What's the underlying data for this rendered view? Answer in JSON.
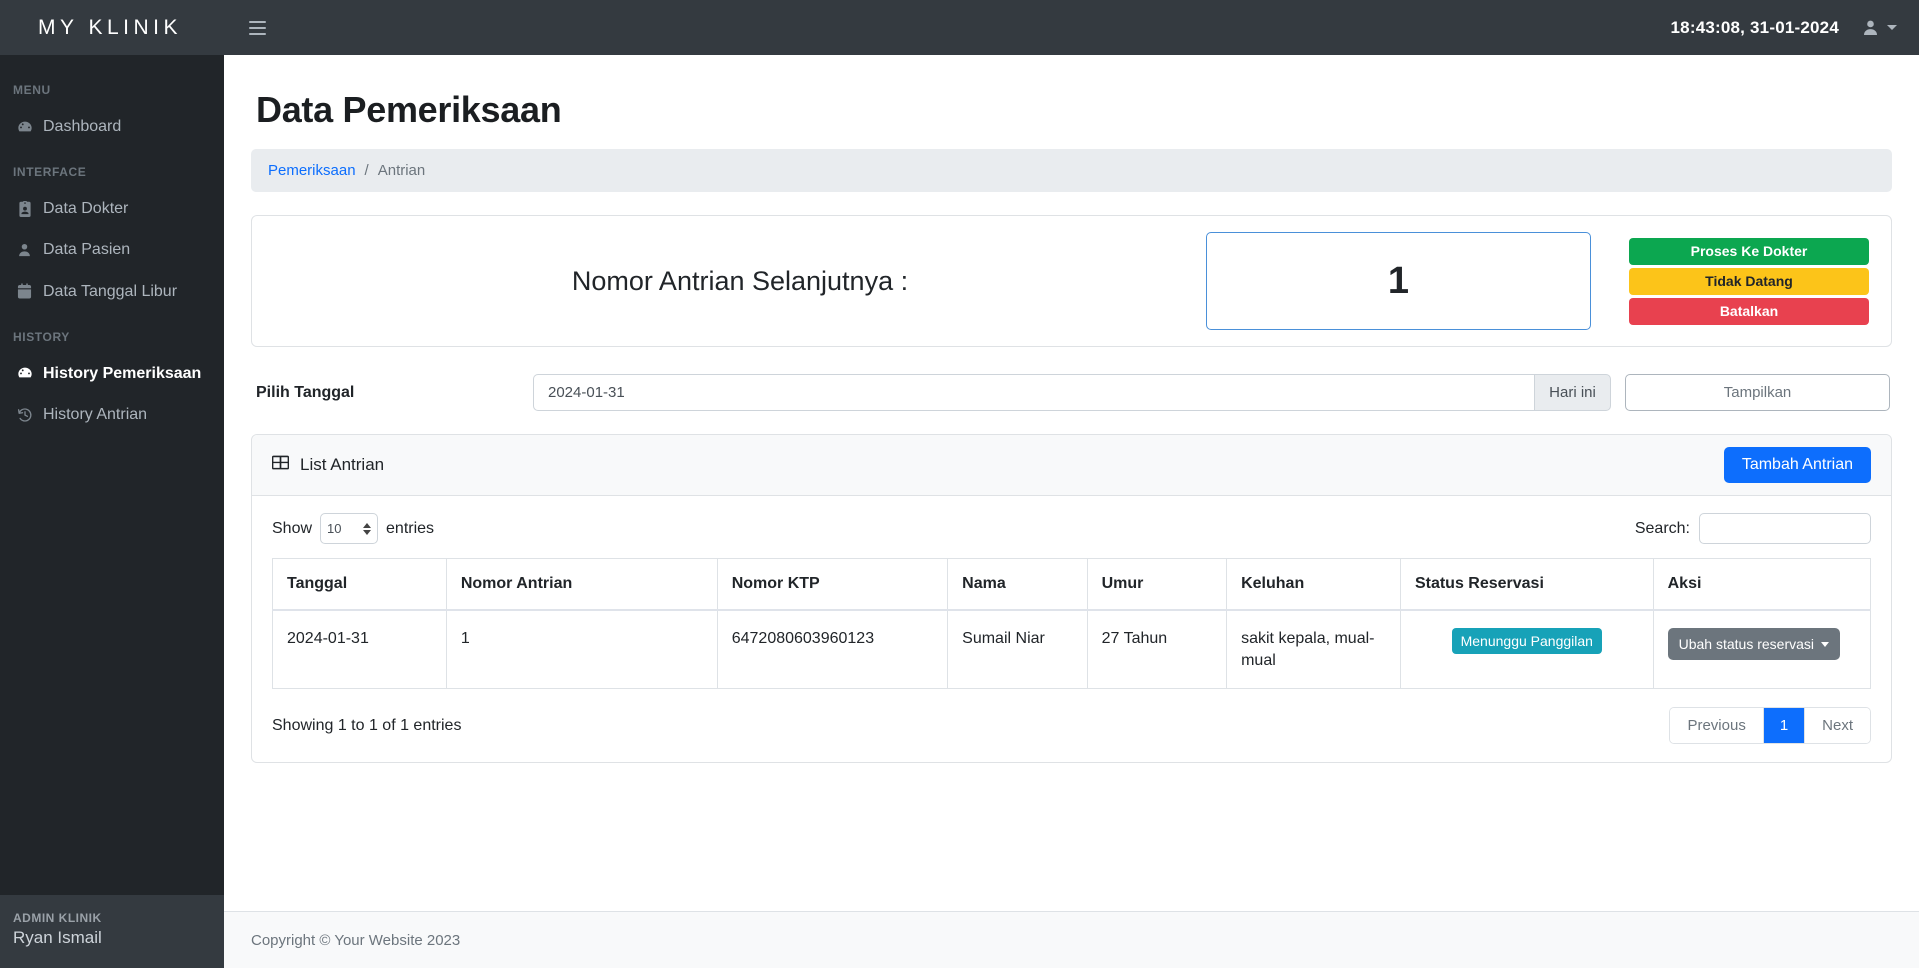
{
  "topbar": {
    "brand": "MY KLINIK",
    "menu_toggle_icon": "hamburger-icon",
    "clock": "18:43:08, 31-01-2024",
    "user_icon": "user-icon"
  },
  "sidebar": {
    "sections": [
      {
        "heading": "MENU",
        "items": [
          {
            "label": "Dashboard",
            "icon": "tachometer-icon",
            "active": false
          }
        ]
      },
      {
        "heading": "INTERFACE",
        "items": [
          {
            "label": "Data Dokter",
            "icon": "id-badge-icon",
            "active": false
          },
          {
            "label": "Data Pasien",
            "icon": "user-icon",
            "active": false
          },
          {
            "label": "Data Tanggal Libur",
            "icon": "calendar-icon",
            "active": false
          }
        ]
      },
      {
        "heading": "HISTORY",
        "items": [
          {
            "label": "History Pemeriksaan",
            "icon": "tachometer-icon",
            "active": true
          },
          {
            "label": "History Antrian",
            "icon": "history-clock-icon",
            "active": false
          }
        ]
      }
    ],
    "footer": {
      "role": "ADMIN KLINIK",
      "name": "Ryan Ismail"
    }
  },
  "page": {
    "title": "Data Pemeriksaan",
    "breadcrumb": {
      "parent": "Pemeriksaan",
      "separator": "/",
      "current": "Antrian"
    }
  },
  "queue": {
    "label": "Nomor Antrian Selanjutnya :",
    "number": "1",
    "buttons": [
      {
        "label": "Proses Ke Dokter",
        "color": "#0ca750",
        "style": "green"
      },
      {
        "label": "Tidak Datang",
        "color": "#fcc419",
        "style": "yellow"
      },
      {
        "label": "Batalkan",
        "color": "#e8414f",
        "style": "red"
      }
    ]
  },
  "date_filter": {
    "label": "Pilih Tanggal",
    "value": "2024-01-31",
    "placeholder": "",
    "today_label": "Hari ini",
    "submit_label": "Tampilkan"
  },
  "list_card": {
    "title": "List Antrian",
    "title_icon": "table-grid-icon",
    "add_button": "Tambah Antrian"
  },
  "datatable": {
    "show_label": "Show",
    "entries_label": "entries",
    "page_length": "10",
    "search_label": "Search:",
    "search_value": "",
    "search_placeholder": "",
    "columns": [
      "Tanggal",
      "Nomor Antrian",
      "Nomor KTP",
      "Nama",
      "Umur",
      "Keluhan",
      "Status Reservasi",
      "Aksi"
    ],
    "rows": [
      {
        "tanggal": "2024-01-31",
        "nomor_antrian": "1",
        "nomor_ktp": "6472080603960123",
        "nama": "Sumail Niar",
        "umur": "27 Tahun",
        "keluhan": "sakit kepala, mual-mual",
        "status": "Menunggu Panggilan",
        "status_color": "#17a2b8",
        "action_label": "Ubah status reservasi"
      }
    ],
    "info": "Showing 1 to 1 of 1 entries",
    "pagination": {
      "previous": "Previous",
      "current": "1",
      "next": "Next",
      "active_color": "#0d6efd"
    }
  },
  "footer": {
    "copyright": "Copyright © Your Website 2023"
  }
}
